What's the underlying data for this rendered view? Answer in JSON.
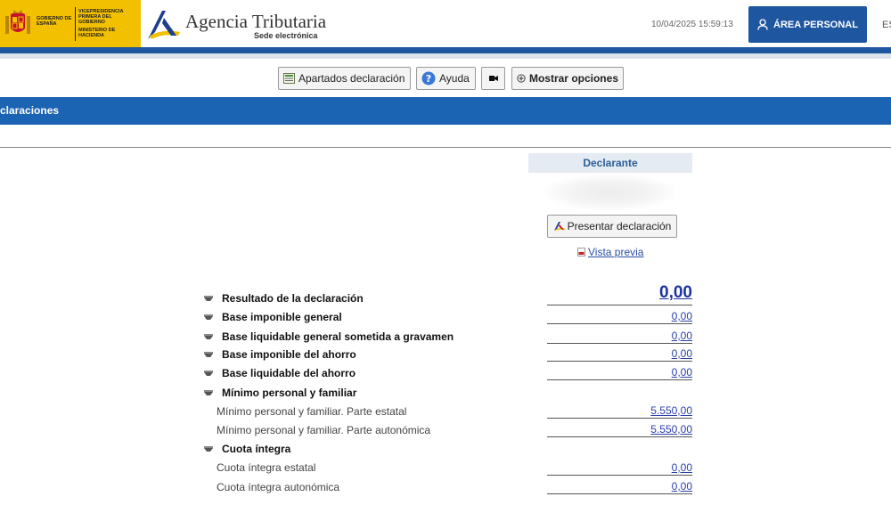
{
  "header": {
    "gov_line1": "GOBIERNO DE ESPAÑA",
    "gov_line2": "VICEPRESIDENCIA PRIMERA DEL GOBIERNO",
    "gov_line3": "MINISTERIO DE HACIENDA",
    "agency_title": "Agencia Tributaria",
    "agency_subtitle": "Sede electrónica",
    "datetime": "10/04/2025 15:59:13",
    "area_button": "ÁREA PERSONAL",
    "language": "ES"
  },
  "toolbar": {
    "apartados": "Apartados declaración",
    "ayuda": "Ayuda",
    "mostrar": "Mostrar opciones"
  },
  "section": {
    "title": "claraciones"
  },
  "declarante": {
    "header": "Declarante",
    "present_button": "Presentar declaración",
    "preview_link": "Vista previa"
  },
  "rows": [
    {
      "label": "Resultado de la declaración",
      "value": "0,00"
    },
    {
      "label": "Base imponible general",
      "value": "0,00"
    },
    {
      "label": "Base liquidable general sometida a gravamen",
      "value": "0,00"
    },
    {
      "label": "Base imponible del ahorro",
      "value": "0,00"
    },
    {
      "label": "Base liquidable del ahorro",
      "value": "0,00"
    },
    {
      "label": "Mínimo personal y familiar",
      "value": ""
    },
    {
      "label": "Mínimo personal y familiar. Parte estatal",
      "value": "5.550,00"
    },
    {
      "label": "Mínimo personal y familiar. Parte autonómica",
      "value": "5.550,00"
    },
    {
      "label": "Cuota íntegra",
      "value": ""
    },
    {
      "label": "Cuota íntegra estatal",
      "value": "0,00"
    },
    {
      "label": "Cuota íntegra autonómica",
      "value": "0,00"
    }
  ],
  "colors": {
    "brand_blue": "#1e56a0",
    "section_blue": "#1b63b3",
    "gov_yellow": "#f3c000",
    "link_blue": "#2a3fa8"
  }
}
